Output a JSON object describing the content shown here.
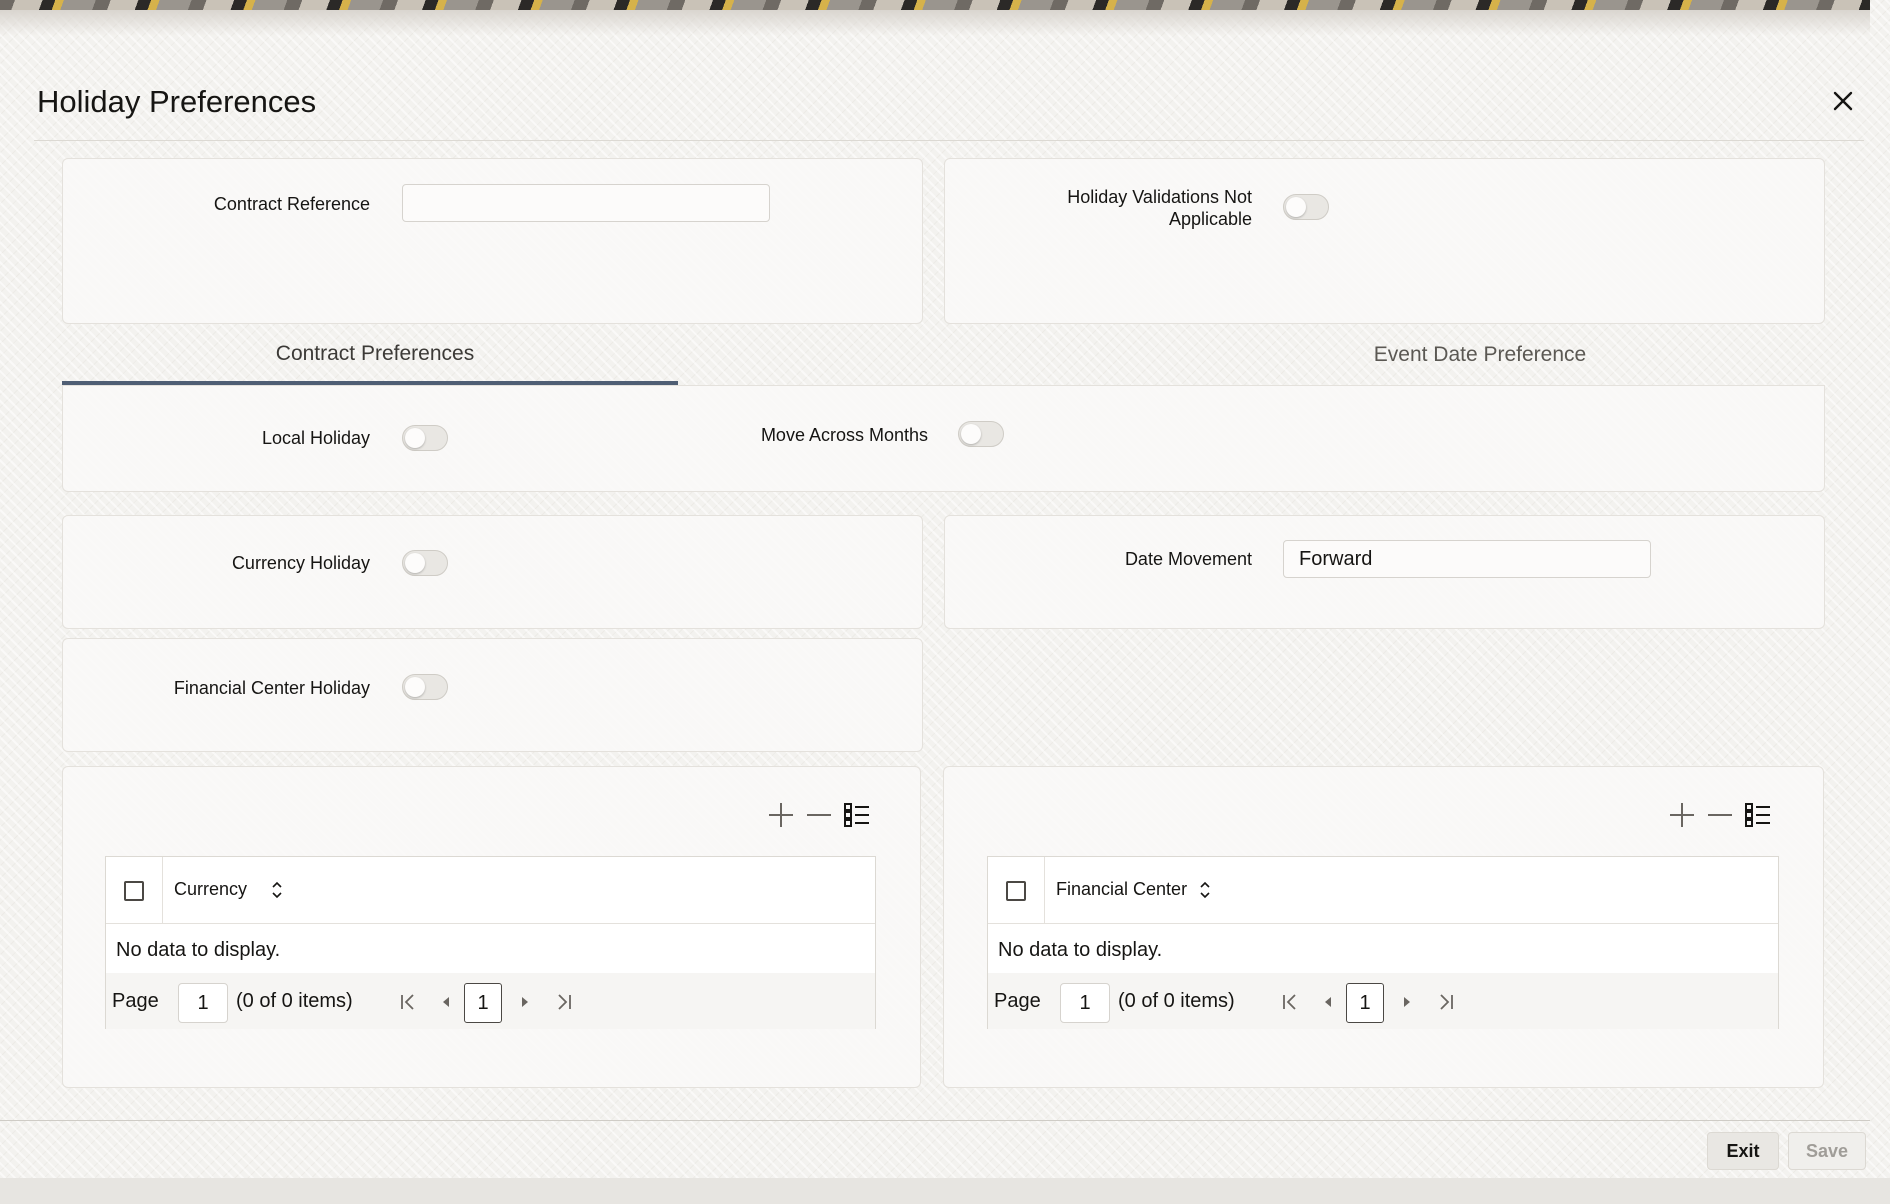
{
  "dialog": {
    "title": "Holiday Preferences",
    "close_icon": "close-icon"
  },
  "header": {
    "contract_reference_label": "Contract Reference",
    "contract_reference_value": "",
    "holiday_validations_label_line1": "Holiday Validations Not",
    "holiday_validations_label_line2": "Applicable",
    "holiday_validations_on": false
  },
  "tabs": [
    {
      "label": "Contract Preferences",
      "selected": true
    },
    {
      "label": "Event Date Preference",
      "selected": false
    }
  ],
  "preferences": {
    "local_holiday_label": "Local Holiday",
    "local_holiday_on": false,
    "move_across_months_label": "Move Across Months",
    "move_across_months_on": false,
    "currency_holiday_label": "Currency Holiday",
    "currency_holiday_on": false,
    "date_movement_label": "Date Movement",
    "date_movement_value": "Forward",
    "financial_center_holiday_label": "Financial Center Holiday",
    "financial_center_holiday_on": false
  },
  "grids": {
    "currency": {
      "column": "Currency",
      "empty_text": "No data to display.",
      "page_label": "Page",
      "page_value": "1",
      "count_text": "(0 of 0 items)",
      "current_page": "1"
    },
    "financial_center": {
      "column": "Financial Center",
      "empty_text": "No data to display.",
      "page_label": "Page",
      "page_value": "1",
      "count_text": "(0 of 0 items)",
      "current_page": "1"
    }
  },
  "footer": {
    "exit_label": "Exit",
    "save_label": "Save"
  },
  "colors": {
    "tab_underline": "#4f5e74",
    "disabled_text": "#a09d98"
  }
}
